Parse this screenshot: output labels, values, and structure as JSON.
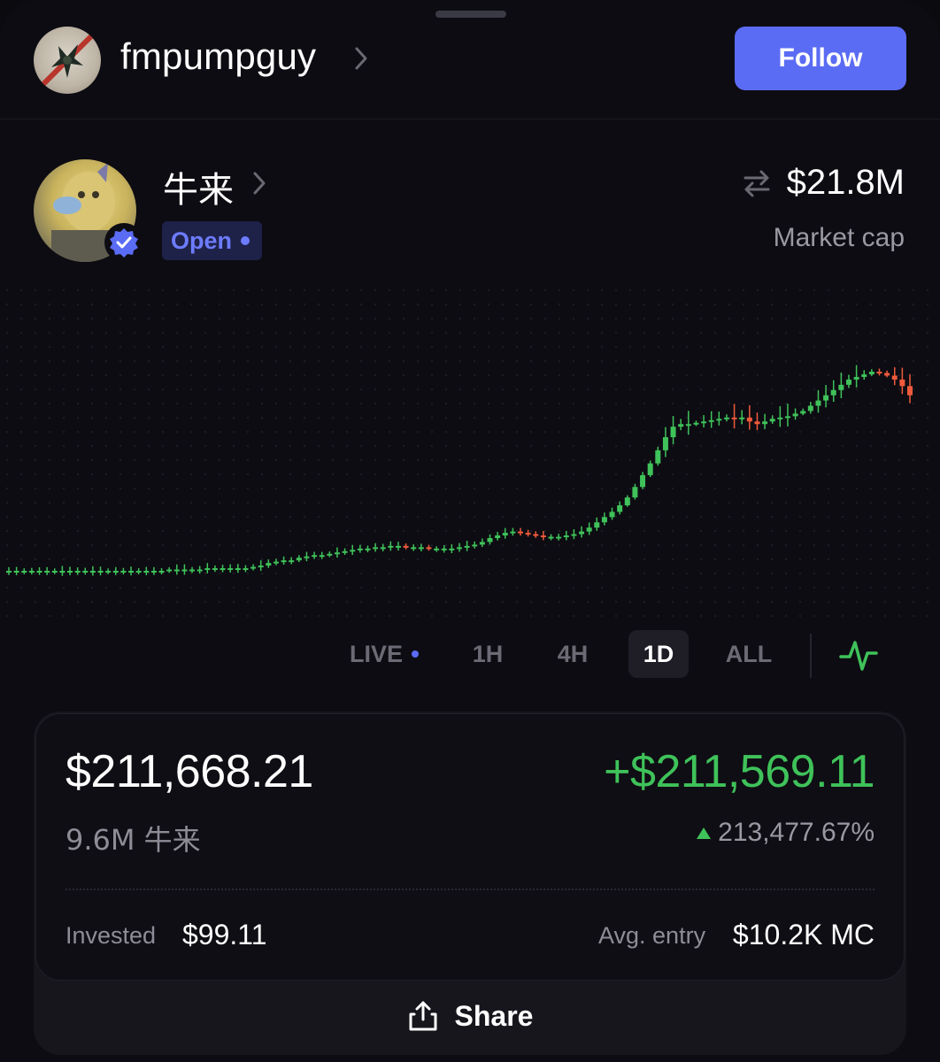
{
  "header": {
    "username": "fmpumpguy",
    "follow_label": "Follow"
  },
  "token": {
    "name": "牛来",
    "status": "Open",
    "market_cap_value": "$21.8M",
    "market_cap_label": "Market cap"
  },
  "chart_data": {
    "type": "candlestick",
    "timeframe": "1D",
    "note_units": "relative price level (arbitrary units)",
    "up_color": "#3fc25a",
    "down_color": "#ef5a3c",
    "trend": [
      0,
      0,
      0,
      0,
      0,
      0,
      0,
      0,
      0,
      0,
      0,
      0,
      0,
      0,
      0,
      0,
      0,
      0,
      0,
      0,
      0,
      1,
      1,
      1,
      1,
      1,
      2,
      2,
      2,
      2,
      2,
      2,
      3,
      4,
      6,
      7,
      8,
      8,
      10,
      11,
      12,
      12,
      13,
      14,
      15,
      16,
      17,
      17,
      18,
      18,
      19,
      19,
      18,
      18,
      18,
      17,
      17,
      17,
      17,
      18,
      19,
      20,
      22,
      25,
      27,
      29,
      30,
      29,
      28,
      27,
      26,
      26,
      26,
      27,
      28,
      30,
      33,
      37,
      41,
      45,
      50,
      56,
      64,
      73,
      82,
      92,
      102,
      110,
      112,
      112,
      113,
      114,
      115,
      116,
      117,
      116,
      117,
      114,
      112,
      114,
      116,
      117,
      118,
      120,
      122,
      126,
      130,
      134,
      138,
      142,
      146,
      148,
      150,
      152,
      151,
      149,
      146,
      141,
      134
    ]
  },
  "tabs": [
    {
      "label": "LIVE"
    },
    {
      "label": "1H"
    },
    {
      "label": "4H"
    },
    {
      "label": "1D"
    },
    {
      "label": "ALL"
    }
  ],
  "active_tab": "1D",
  "position": {
    "value": "$211,668.21",
    "pnl": "+$211,569.11",
    "holdings": "9.6M 牛来",
    "pnl_percent": "213,477.67%",
    "invested_label": "Invested",
    "invested_value": "$99.11",
    "avg_entry_label": "Avg. entry",
    "avg_entry_value": "$10.2K MC"
  },
  "share_label": "Share",
  "colors": {
    "accent": "#5b6cf4",
    "positive": "#3fc25a",
    "negative": "#ef5a3c",
    "background": "#0d0c12"
  },
  "icons": [
    "user-avatar",
    "chevron-right-icon",
    "swap-arrows-icon",
    "verified-badge-icon",
    "pulse-chart-icon",
    "share-icon"
  ]
}
